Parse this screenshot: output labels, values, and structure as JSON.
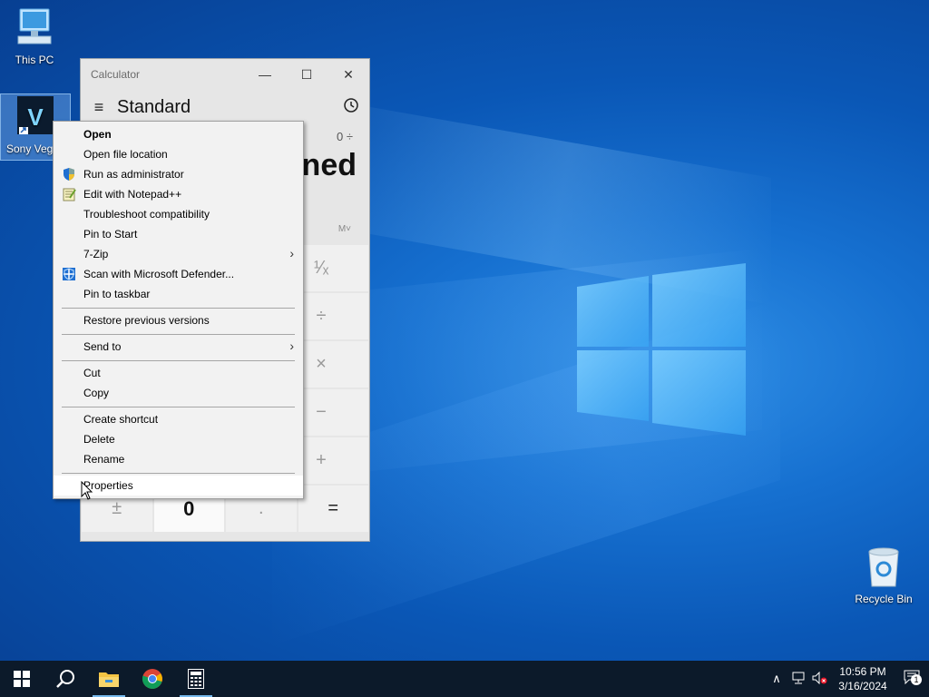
{
  "desktop": {
    "icons": [
      {
        "label": "This PC"
      },
      {
        "label": "Sony Vegas"
      },
      {
        "label": "Recycle Bin"
      }
    ]
  },
  "calculator": {
    "window_title": "Calculator",
    "minimize": "—",
    "maximize": "☐",
    "close": "✕",
    "mode": "Standard",
    "expression": "0 ÷",
    "result": "ned",
    "memory": "M˅",
    "keys": {
      "reciprocal": "¹⁄ₓ",
      "divide": "÷",
      "multiply": "×",
      "minus": "−",
      "plus": "+",
      "negate": "±",
      "zero": "0",
      "decimal": ".",
      "equals": "="
    }
  },
  "context_menu": {
    "items": [
      {
        "label": "Open",
        "bold": true
      },
      {
        "label": "Open file location"
      },
      {
        "label": "Run as administrator",
        "icon": "shield-icon"
      },
      {
        "label": "Edit with Notepad++",
        "icon": "notepadpp-icon"
      },
      {
        "label": "Troubleshoot compatibility"
      },
      {
        "label": "Pin to Start"
      },
      {
        "label": "7-Zip",
        "submenu": true
      },
      {
        "label": "Scan with Microsoft Defender...",
        "icon": "defender-icon"
      },
      {
        "label": "Pin to taskbar"
      },
      {
        "label": "Restore previous versions"
      },
      {
        "label": "Send to",
        "submenu": true
      },
      {
        "label": "Cut"
      },
      {
        "label": "Copy"
      },
      {
        "label": "Create shortcut"
      },
      {
        "label": "Delete"
      },
      {
        "label": "Rename"
      },
      {
        "label": "Properties",
        "hover": true
      }
    ],
    "submenu_arrow": "›"
  },
  "taskbar": {
    "apps": [
      "start-icon",
      "search-icon",
      "file-explorer-icon",
      "chrome-icon",
      "calculator-icon"
    ],
    "tray": {
      "chevron": "∧",
      "time": "10:56 PM",
      "date": "3/16/2024",
      "notification_count": "1"
    }
  }
}
